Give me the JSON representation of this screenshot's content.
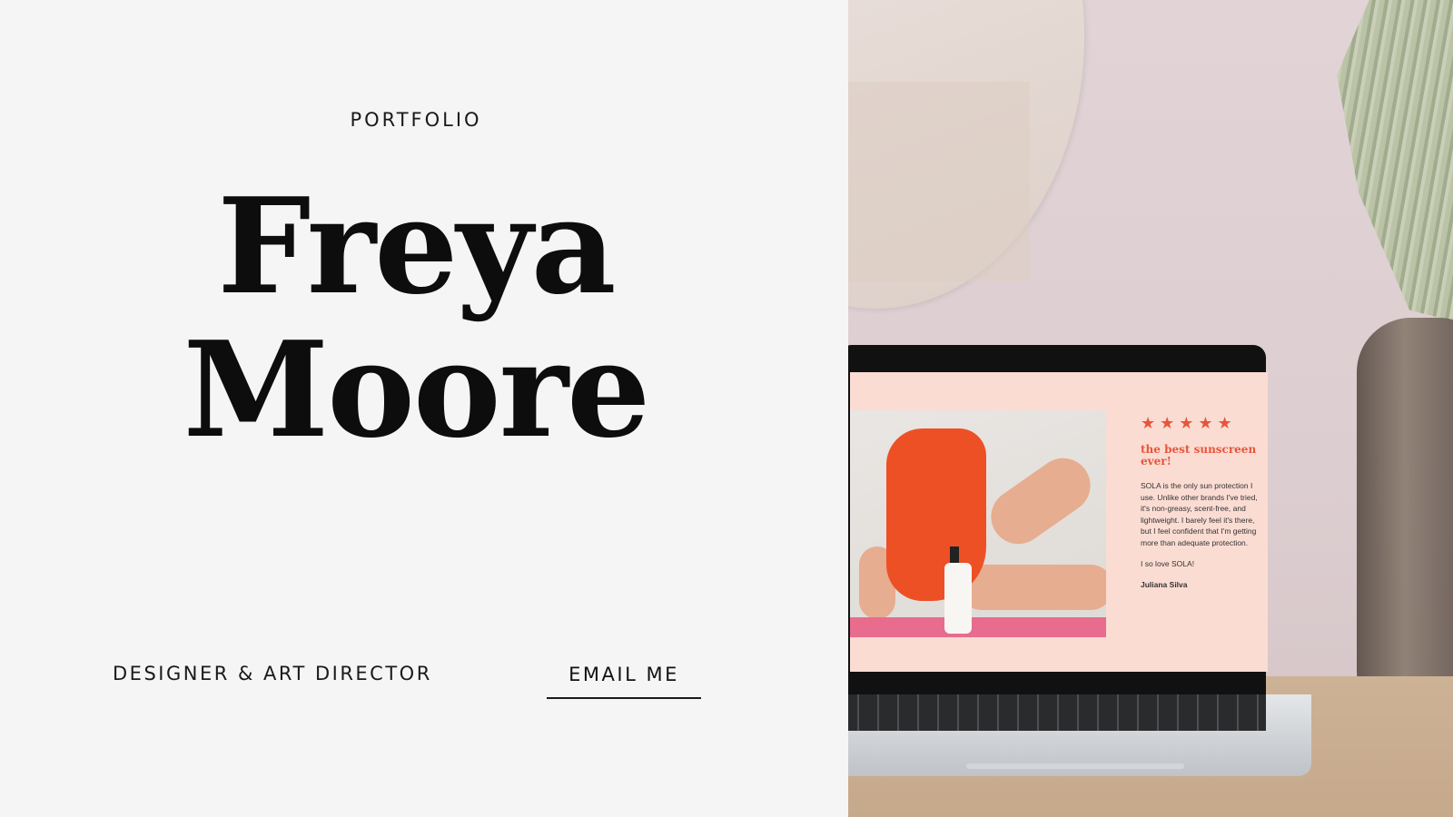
{
  "hero": {
    "eyebrow": "PORTFOLIO",
    "first_name": "Freya",
    "last_name": "Moore",
    "role": "DESIGNER & ART DIRECTOR",
    "email_button": "EMAIL ME"
  },
  "laptop_screen": {
    "stars": "★★★★★",
    "review_title": "the best sunscreen ever!",
    "review_body": "SOLA is the only sun protection I use. Unlike other brands I've tried, it's non-greasy, scent-free, and lightweight. I barely feel it's there, but I feel confident that I'm getting more than adequate protection.",
    "review_love": "I so love SOLA!",
    "review_author": "Juliana Silva"
  },
  "colors": {
    "background": "#f5f5f5",
    "text": "#111111",
    "accent": "#e8553a",
    "screen_pink": "#fbdcd3"
  }
}
